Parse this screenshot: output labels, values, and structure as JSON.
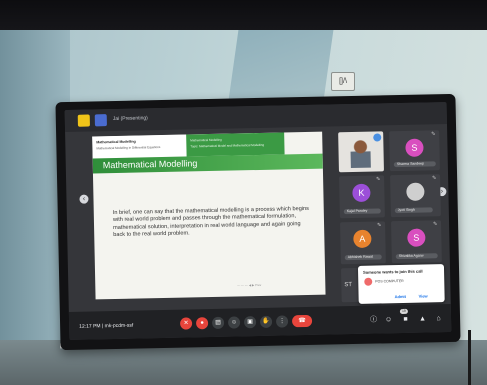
{
  "room": {
    "outlet_label": "[]/\\"
  },
  "meeting": {
    "presenter_label": "Jai (Presenting)",
    "clock": "12:17 PM | mk-pcdm-ssf",
    "slide": {
      "header_left_line1": "Mathematical Modelling",
      "header_left_line2": "Mathematical Modelling in Differential Equations",
      "header_right_line1": "Mathematical Modelling",
      "header_right_line2": "Topic: Mathematical Model and Mathematical Modelling",
      "title": "Mathematical Modelling",
      "body": "In brief, one can say that the mathematical modelling is a process which begins with real world problem and passes through the mathematical formulation, mathematical solution, interpretation in real world language and again going back to the real world problem.",
      "nav": "— — — ◀ ▶ Prev"
    },
    "participants": [
      {
        "initial": "",
        "name": ""
      },
      {
        "initial": "S",
        "name": "Sharma Sandeep",
        "color": "#d94fbf"
      },
      {
        "initial": "K",
        "name": "Kajal Pandey",
        "color": "#9c4fd9"
      },
      {
        "initial": "",
        "name": "Jyoti Singh",
        "color": "#cfcfcf"
      },
      {
        "initial": "A",
        "name": "Abhishek Rawat",
        "color": "#e8832e"
      },
      {
        "initial": "S",
        "name": "Shivalika Agarw",
        "color": "#d94fbf"
      },
      {
        "initial": "ST",
        "name": "",
        "color": "#5b5d62"
      }
    ],
    "popup": {
      "title": "Someone wants to join this call",
      "name": "POS COMPUTER",
      "admit": "Admit",
      "view": "View"
    },
    "controls": {
      "mic": "✕",
      "cam": "●",
      "cc": "▤",
      "emoji": "☺",
      "present": "▣",
      "hand": "✋",
      "more": "⋮",
      "leave": "☎",
      "info": "ⓘ",
      "people": "☺",
      "chat": "■",
      "activities": "▲",
      "lock": "⌂",
      "people_count": "19"
    }
  }
}
